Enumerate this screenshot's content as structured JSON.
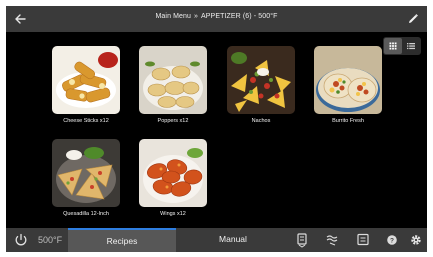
{
  "header": {
    "menu": "Main Menu",
    "separator": "»",
    "category": "APPETIZER (6) - 500°F",
    "back_icon": "arrow-left-icon",
    "edit_icon": "pencil-icon"
  },
  "view_toggle": {
    "selected": "grid",
    "grid_icon": "grid-icon",
    "list_icon": "list-icon"
  },
  "recipes": [
    {
      "label": "Cheese Sticks x12"
    },
    {
      "label": "Poppers x12"
    },
    {
      "label": "Nachos"
    },
    {
      "label": "Burrito Fresh"
    },
    {
      "label": "Quesadilla 12-Inch"
    },
    {
      "label": "Wings x12"
    }
  ],
  "footer": {
    "power_icon": "power-icon",
    "temperature": "500°F",
    "tabs": [
      {
        "label": "Recipes",
        "active": true
      },
      {
        "label": "Manual",
        "active": false
      }
    ],
    "icons": [
      "oven-clean-icon",
      "fan-icon",
      "screen-icon",
      "help-icon",
      "gear-icon"
    ]
  },
  "colors": {
    "active_tab_accent": "#2f7ee0",
    "bar": "#3a3a3a",
    "background": "#000000"
  }
}
